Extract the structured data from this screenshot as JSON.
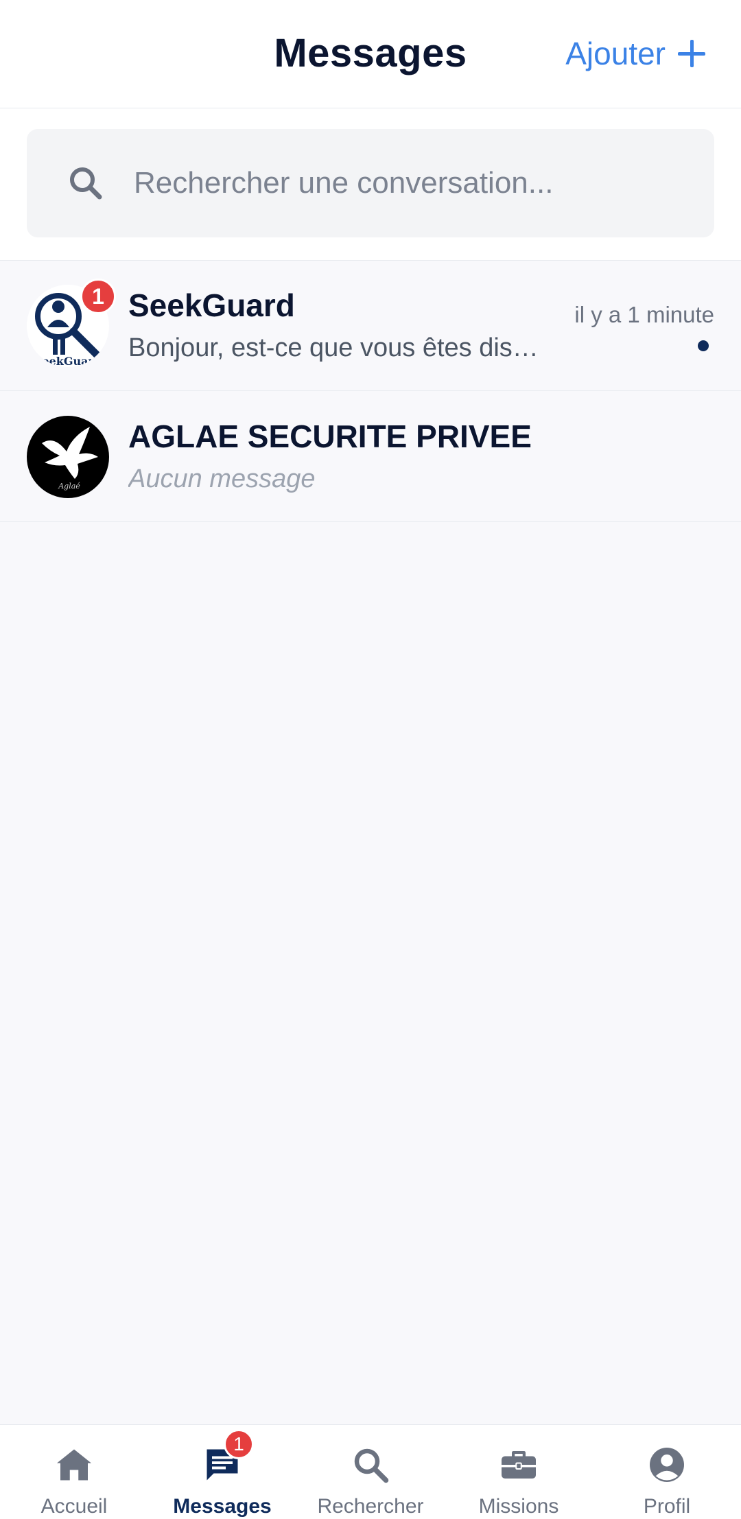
{
  "header": {
    "title": "Messages",
    "add_label": "Ajouter"
  },
  "search": {
    "placeholder": "Rechercher une conversation..."
  },
  "conversations": [
    {
      "name": "SeekGuard",
      "preview": "Bonjour, est-ce que vous êtes dis…",
      "time": "il y a 1 minute",
      "unread_count": "1",
      "avatar_text": "SeekGuard",
      "unread": true
    },
    {
      "name": "AGLAE SECURITE PRIVEE",
      "preview": "Aucun message",
      "time": "",
      "avatar_text": "Aglaé",
      "unread": false
    }
  ],
  "nav": {
    "items": [
      {
        "label": "Accueil",
        "icon": "home-icon"
      },
      {
        "label": "Messages",
        "icon": "messages-icon",
        "badge": "1",
        "active": true
      },
      {
        "label": "Rechercher",
        "icon": "search-icon"
      },
      {
        "label": "Missions",
        "icon": "briefcase-icon"
      },
      {
        "label": "Profil",
        "icon": "profile-icon"
      }
    ]
  },
  "colors": {
    "accent": "#3b82e6",
    "primary": "#0f2b5b",
    "badge": "#e53e3e"
  }
}
